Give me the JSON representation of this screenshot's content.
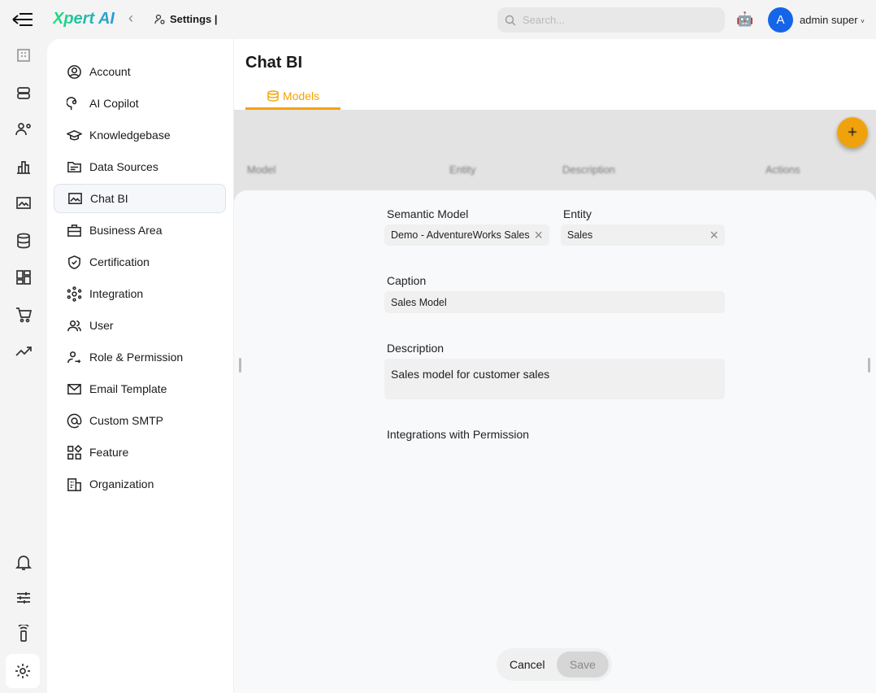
{
  "header": {
    "brand": "Xpert AI",
    "breadcrumb": "Settings |",
    "search_placeholder": "Search...",
    "avatar_letter": "A",
    "user_name": "admin super"
  },
  "rail": [
    "building-icon",
    "robot-icon",
    "users-cog-icon",
    "chart-bar-icon",
    "image-message-icon",
    "database-icon",
    "grid-icon",
    "cart-icon",
    "trend-icon",
    "bell-icon",
    "sliders-icon",
    "remote-icon",
    "gear-icon"
  ],
  "sidebar": {
    "items": [
      {
        "label": "Account",
        "icon": "account-circle-icon"
      },
      {
        "label": "AI Copilot",
        "icon": "copilot-icon"
      },
      {
        "label": "Knowledgebase",
        "icon": "graduation-cap-icon"
      },
      {
        "label": "Data Sources",
        "icon": "folder-icon"
      },
      {
        "label": "Chat BI",
        "icon": "chat-image-icon"
      },
      {
        "label": "Business Area",
        "icon": "briefcase-icon"
      },
      {
        "label": "Certification",
        "icon": "shield-check-icon"
      },
      {
        "label": "Integration",
        "icon": "hub-icon"
      },
      {
        "label": "User",
        "icon": "users-icon"
      },
      {
        "label": "Role & Permission",
        "icon": "user-key-icon"
      },
      {
        "label": "Email Template",
        "icon": "mail-icon"
      },
      {
        "label": "Custom SMTP",
        "icon": "at-icon"
      },
      {
        "label": "Feature",
        "icon": "widgets-icon"
      },
      {
        "label": "Organization",
        "icon": "org-icon"
      }
    ],
    "active": "Chat BI"
  },
  "page": {
    "title": "Chat BI",
    "tab": "Models",
    "accent": "#f5a300"
  },
  "table": {
    "columns": [
      "Model",
      "Entity",
      "Description",
      "Actions"
    ]
  },
  "form": {
    "semantic_model_label": "Semantic Model",
    "semantic_model_value": "Demo - AdventureWorks Sales",
    "entity_label": "Entity",
    "entity_value": "Sales",
    "caption_label": "Caption",
    "caption_value": "Sales Model",
    "description_label": "Description",
    "description_value": "Sales model for customer sales",
    "integrations_label": "Integrations with Permission",
    "cancel": "Cancel",
    "save": "Save"
  }
}
